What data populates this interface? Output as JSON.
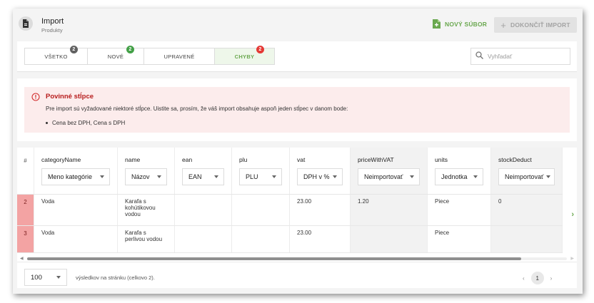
{
  "header": {
    "title": "Import",
    "subtitle": "Produkty",
    "new_file_label": "NOVÝ SÚBOR",
    "finish_label": "DOKONČIŤ IMPORT"
  },
  "tabs": [
    {
      "label": "VŠETKO",
      "count": "2",
      "badge_color": "#616161"
    },
    {
      "label": "NOVÉ",
      "count": "2",
      "badge_color": "#43a047"
    },
    {
      "label": "UPRAVENÉ",
      "count": "",
      "badge_color": ""
    },
    {
      "label": "CHYBY",
      "count": "2",
      "badge_color": "#e53935",
      "active": true
    }
  ],
  "search": {
    "placeholder": "Vyhľadať",
    "value": ""
  },
  "alert": {
    "title": "Povinné stĺpce",
    "text": "Pre import sú vyžadované niektoré stĺpce. Uistite sa, prosím, že váš import obsahuje aspoň jeden stĺpec v danom bode:",
    "items": [
      "Cena bez DPH, Cena s DPH"
    ]
  },
  "table": {
    "rownum_header": "#",
    "columns": [
      {
        "name": "categoryName",
        "mapping": "Meno kategórie",
        "gray": false
      },
      {
        "name": "name",
        "mapping": "Názov",
        "gray": false
      },
      {
        "name": "ean",
        "mapping": "EAN",
        "gray": false
      },
      {
        "name": "plu",
        "mapping": "PLU",
        "gray": false
      },
      {
        "name": "vat",
        "mapping": "DPH v %",
        "gray": false
      },
      {
        "name": "priceWithVAT",
        "mapping": "Neimportovať",
        "gray": true
      },
      {
        "name": "units",
        "mapping": "Jednotka",
        "gray": false
      },
      {
        "name": "stockDeduct",
        "mapping": "Neimportovať",
        "gray": true
      }
    ],
    "rows": [
      {
        "num": "2",
        "cells": [
          "Voda",
          "Karafa s kohútikovou vodou",
          "",
          "",
          "23.00",
          "1.20",
          "Piece",
          "0"
        ]
      },
      {
        "num": "3",
        "cells": [
          "Voda",
          "Karafa s perlivou vodou",
          "",
          "",
          "23.00",
          "",
          "Piece",
          ""
        ]
      }
    ]
  },
  "footer": {
    "per_page": "100",
    "per_page_text": "výsledkov na stránku (celkovo 2).",
    "page": "1"
  },
  "colors": {
    "accent": "#6aa84f",
    "error": "#b71c1c",
    "error_bg": "#fcecec",
    "row_error": "#f3a3a3"
  }
}
